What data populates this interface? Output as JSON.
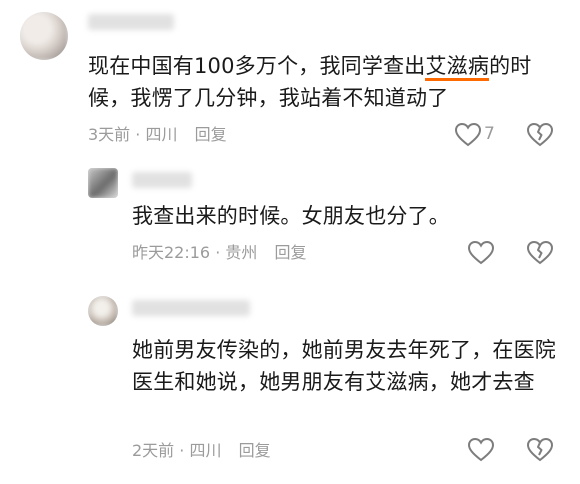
{
  "comments": [
    {
      "text_before_highlight": "现在中国有100多万个，我同学查出",
      "highlight": "艾滋病",
      "text_after_highlight": "的时候，我愣了几分钟，我站着不知道动了",
      "time": "3天前",
      "separator": "·",
      "location": "四川",
      "reply_label": "回复",
      "like_count": "7"
    },
    {
      "text": "我查出来的时候。女朋友也分了。",
      "time": "昨天22:16",
      "separator": "·",
      "location": "贵州",
      "reply_label": "回复"
    },
    {
      "text": "她前男友传染的，她前男友去年死了，在医院医生和她说，她男朋友有艾滋病，她才去查",
      "time": "2天前",
      "separator": "·",
      "location": "四川",
      "reply_label": "回复"
    }
  ],
  "colors": {
    "highlight_underline": "#ff6a00",
    "meta_gray": "#9b9b9b",
    "icon_gray": "#7d7d7d"
  },
  "icons": {
    "like": "heart-outline-icon",
    "dislike": "broken-heart-outline-icon"
  }
}
